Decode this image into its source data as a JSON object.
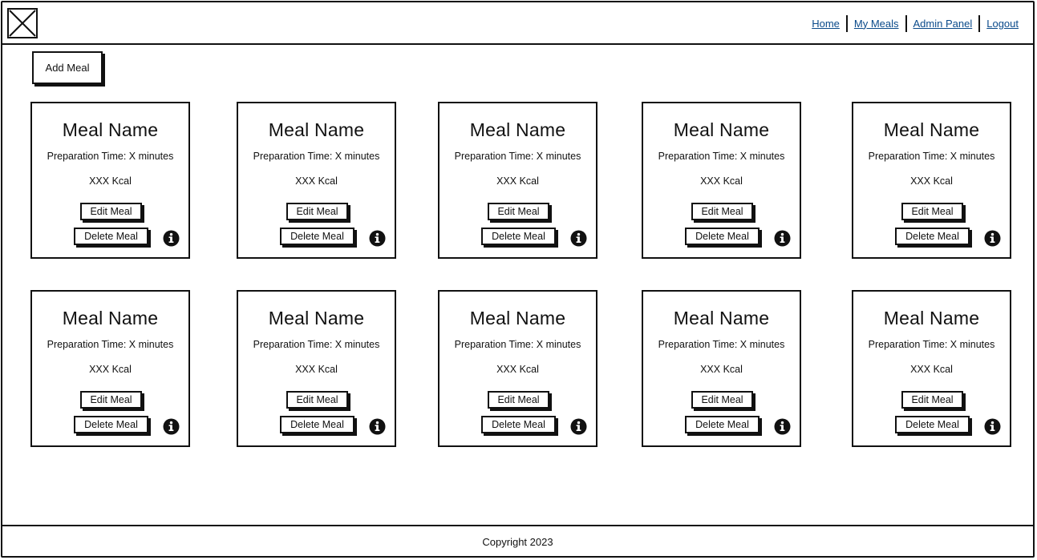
{
  "header": {
    "logo_icon": "image-placeholder-icon",
    "nav": [
      "Home",
      "My Meals",
      "Admin Panel",
      "Logout"
    ]
  },
  "actions": {
    "add_meal": "Add Meal"
  },
  "cards": [
    {
      "name": "Meal Name",
      "prep": "Preparation Time: X minutes",
      "kcal": "XXX Kcal",
      "edit": "Edit Meal",
      "delete": "Delete Meal"
    },
    {
      "name": "Meal Name",
      "prep": "Preparation Time: X minutes",
      "kcal": "XXX Kcal",
      "edit": "Edit Meal",
      "delete": "Delete Meal"
    },
    {
      "name": "Meal Name",
      "prep": "Preparation Time: X minutes",
      "kcal": "XXX Kcal",
      "edit": "Edit Meal",
      "delete": "Delete Meal"
    },
    {
      "name": "Meal Name",
      "prep": "Preparation Time: X minutes",
      "kcal": "XXX Kcal",
      "edit": "Edit Meal",
      "delete": "Delete Meal"
    },
    {
      "name": "Meal Name",
      "prep": "Preparation Time: X minutes",
      "kcal": "XXX Kcal",
      "edit": "Edit Meal",
      "delete": "Delete Meal"
    },
    {
      "name": "Meal Name",
      "prep": "Preparation Time: X minutes",
      "kcal": "XXX Kcal",
      "edit": "Edit Meal",
      "delete": "Delete Meal"
    },
    {
      "name": "Meal Name",
      "prep": "Preparation Time: X minutes",
      "kcal": "XXX Kcal",
      "edit": "Edit Meal",
      "delete": "Delete Meal"
    },
    {
      "name": "Meal Name",
      "prep": "Preparation Time: X minutes",
      "kcal": "XXX Kcal",
      "edit": "Edit Meal",
      "delete": "Delete Meal"
    },
    {
      "name": "Meal Name",
      "prep": "Preparation Time: X minutes",
      "kcal": "XXX Kcal",
      "edit": "Edit Meal",
      "delete": "Delete Meal"
    },
    {
      "name": "Meal Name",
      "prep": "Preparation Time: X minutes",
      "kcal": "XXX Kcal",
      "edit": "Edit Meal",
      "delete": "Delete Meal"
    }
  ],
  "footer": {
    "text": "Copyright 2023"
  },
  "colors": {
    "link": "#0a4a8a",
    "ink": "#111111",
    "background": "#ffffff"
  }
}
